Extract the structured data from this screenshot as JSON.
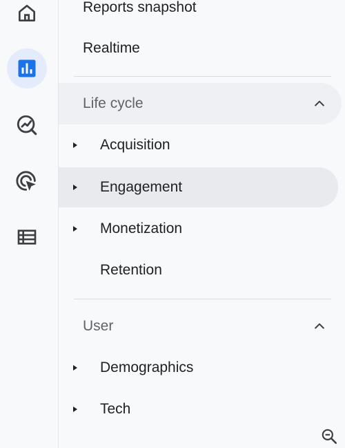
{
  "rail": {
    "items": [
      {
        "icon": "home-icon",
        "active": false
      },
      {
        "icon": "reports-bar-chart-icon",
        "active": true
      },
      {
        "icon": "explore-trend-icon",
        "active": false
      },
      {
        "icon": "advertising-cursor-icon",
        "active": false
      },
      {
        "icon": "configure-list-icon",
        "active": false
      }
    ],
    "active_color": "#1a73e8"
  },
  "nav": {
    "reports_snapshot": "Reports snapshot",
    "realtime": "Realtime",
    "life_cycle": {
      "title": "Life cycle",
      "expanded": true,
      "items": [
        {
          "label": "Acquisition",
          "has_children": true
        },
        {
          "label": "Engagement",
          "has_children": true,
          "selected": true
        },
        {
          "label": "Monetization",
          "has_children": true
        },
        {
          "label": "Retention",
          "has_children": false
        }
      ]
    },
    "user": {
      "title": "User",
      "expanded": true,
      "items": [
        {
          "label": "Demographics",
          "has_children": true
        },
        {
          "label": "Tech",
          "has_children": true
        }
      ]
    }
  },
  "footer": {
    "zoom_icon": "zoom-out-icon"
  }
}
